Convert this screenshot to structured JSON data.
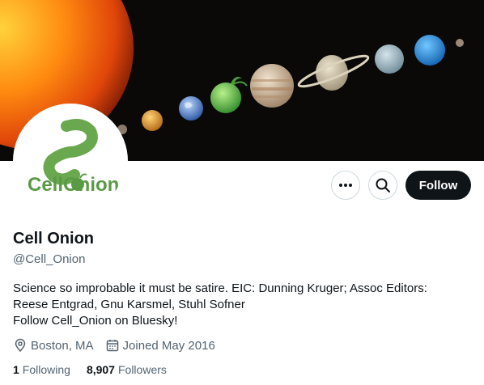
{
  "profile": {
    "name": "Cell Onion",
    "handle": "@Cell_Onion",
    "bio_lines": [
      "Science so improbable it must be satire. EIC:  Dunning Kruger;  Assoc Editors:",
      "Reese Entgrad, Gnu Karsmel, Stuhl Sofner",
      "Follow Cell_Onion on Bluesky!"
    ],
    "location": "Boston, MA",
    "joined": "Joined May 2016",
    "following_count": "1",
    "following_label": "Following",
    "followers_count": "8,907",
    "followers_label": "Followers"
  },
  "logo": {
    "text": "CellOnion"
  },
  "actions": {
    "more_icon": "more-horizontal-icon",
    "search_icon": "search-icon",
    "follow_label": "Follow"
  },
  "icons": {
    "location": "location-pin-icon",
    "joined": "calendar-icon"
  },
  "colors": {
    "primary_text": "#0f1419",
    "secondary_text": "#536471",
    "logo_green": "#6aa84f",
    "follow_bg": "#0f1419"
  }
}
